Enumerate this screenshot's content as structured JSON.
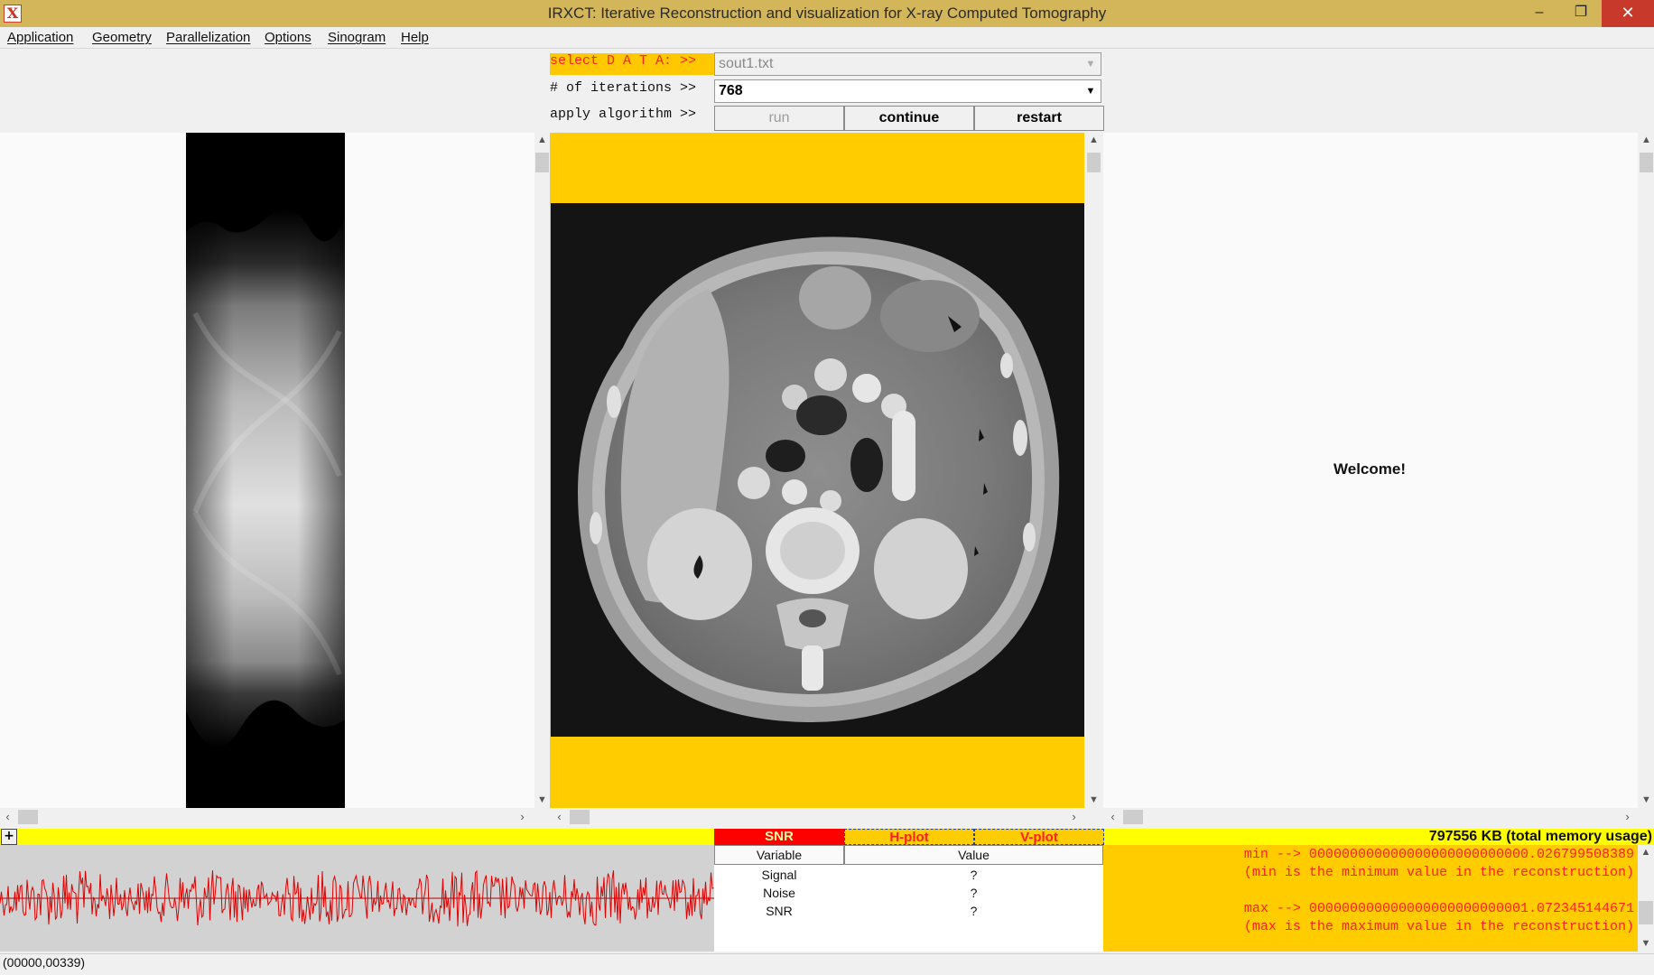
{
  "window": {
    "title": "IRXCT: Iterative Reconstruction and visualization for X-ray Computed Tomography",
    "app_icon": "X",
    "minimize": "–",
    "maximize": "❐",
    "close": "✕"
  },
  "menu": [
    "Application",
    "Geometry",
    "Parallelization",
    "Options",
    "Sinogram",
    "Help"
  ],
  "controls": {
    "select_data_label": "select D A T A: >>",
    "data_value": "sout1.txt",
    "iterations_label": "# of iterations >>",
    "iterations_value": "768",
    "apply_label": "apply algorithm >>",
    "run": "run",
    "continue": "continue",
    "restart": "restart"
  },
  "welcome": "Welcome!",
  "bottom_tabs": {
    "snr": "SNR",
    "hplot": "H-plot",
    "vplot": "V-plot",
    "expand": "+"
  },
  "memory_usage": "797556 KB (total memory usage)",
  "table": {
    "headers": [
      "Variable",
      "Value"
    ],
    "rows": [
      {
        "variable": "Signal",
        "value": "?"
      },
      {
        "variable": "Noise",
        "value": "?"
      },
      {
        "variable": "SNR",
        "value": "?"
      }
    ]
  },
  "log": {
    "line1": "min --> 000000000000000000000000000.026799508389",
    "line2": "(min is the minimum value in the reconstruction)",
    "line3": "max --> 000000000000000000000000001.072345144671",
    "line4": "(max is the maximum value in the reconstruction)"
  },
  "status": "(00000,00339)",
  "colors": {
    "titlebar": "#d4b65a",
    "panel_yellow": "#ffcc00",
    "strip_yellow": "#ffff00",
    "accent_red": "#ff2020",
    "noise_signal": "#e00000"
  },
  "icons": [
    "app-x-icon",
    "minimize-icon",
    "maximize-icon",
    "close-icon",
    "dropdown-arrow-icon",
    "scroll-arrow-icon",
    "expand-plus-icon"
  ]
}
